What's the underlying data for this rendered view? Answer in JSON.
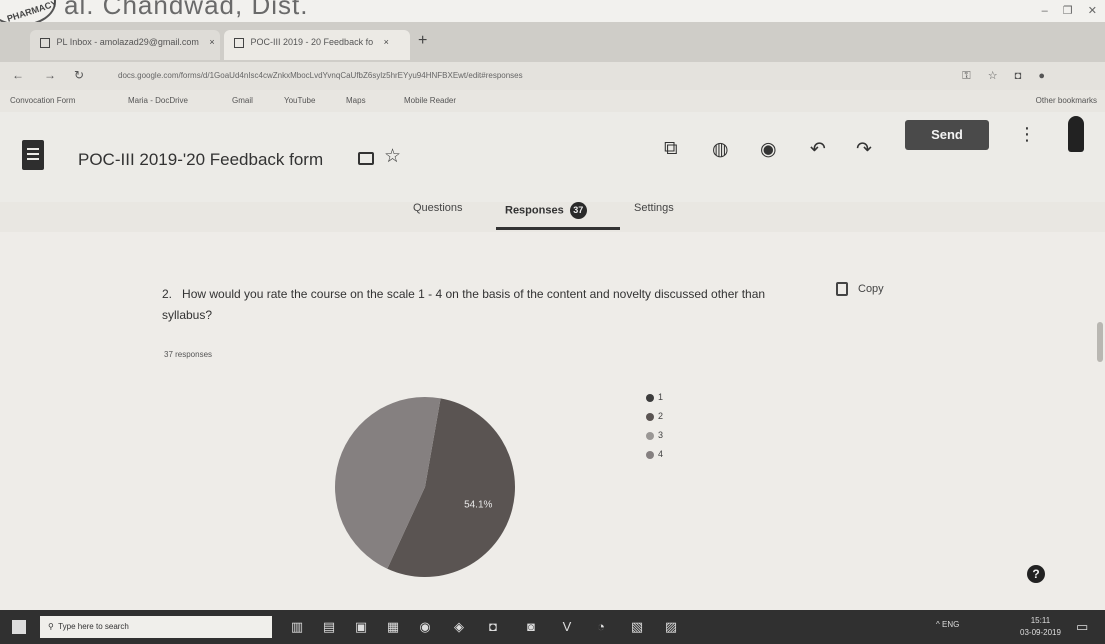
{
  "banner": {
    "stamp_text": "PHARMACY",
    "header_text": "al. Chandwad, Dist."
  },
  "browser": {
    "tabs": [
      {
        "label": "PL Inbox - amolazad29@gmail.com"
      },
      {
        "label": "POC-III 2019 - 20 Feedback fo"
      }
    ],
    "new_tab_label": "+",
    "url": "docs.google.com/forms/d/1GoaUd4nIsc4cwZnkxMbocLvdYvnqCaUfbZ6sylz5hrEYyu94HNFBXEwt/edit#responses",
    "bookmarks": [
      {
        "label": "Convocation Form"
      },
      {
        "label": "Maria - DocDrive"
      },
      {
        "label": "Gmail"
      },
      {
        "label": "YouTube"
      },
      {
        "label": "Maps"
      },
      {
        "label": "Mobile Reader"
      }
    ],
    "other_bookmarks": "Other bookmarks"
  },
  "app": {
    "form_title": "POC-III 2019-'20 Feedback form",
    "send_label": "Send",
    "tabs": {
      "questions": "Questions",
      "responses": "Responses",
      "responses_count": "37",
      "settings": "Settings"
    }
  },
  "question": {
    "number": "2.",
    "text": "How would you rate the course on the scale 1 - 4 on the basis of the content and novelty discussed other than syllabus?",
    "copy_label": "Copy",
    "responses_label": "37 responses"
  },
  "chart_data": {
    "type": "pie",
    "title": "",
    "categories": [
      "1",
      "2",
      "3",
      "4"
    ],
    "values": [
      0,
      54.1,
      0,
      45.9
    ],
    "slice_labels": [
      "",
      "54.1%",
      "",
      ""
    ],
    "colors": [
      "#3c3c3c",
      "#5a5452",
      "#9a9795",
      "#858080"
    ],
    "legend_placement": "right"
  },
  "taskbar": {
    "search_placeholder": "Type here to search",
    "tray_text": "^ ENG",
    "time": "15:11",
    "date": "03-09-2019"
  }
}
